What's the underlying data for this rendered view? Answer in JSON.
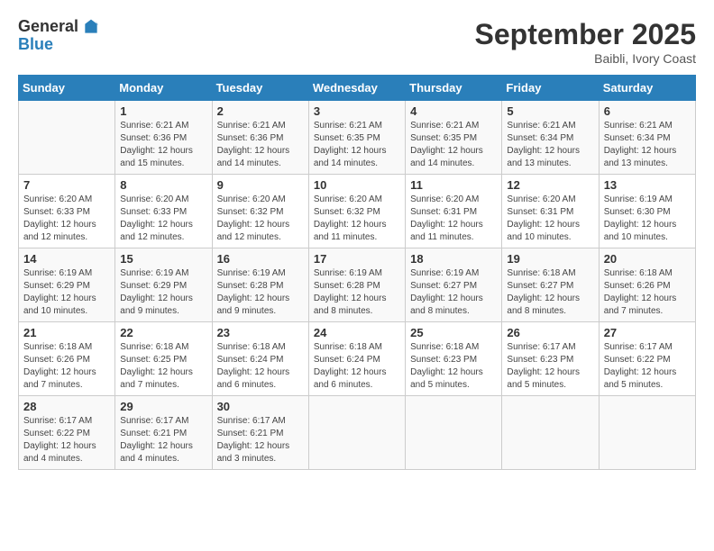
{
  "logo": {
    "general": "General",
    "blue": "Blue"
  },
  "header": {
    "month": "September 2025",
    "location": "Baibli, Ivory Coast"
  },
  "days_of_week": [
    "Sunday",
    "Monday",
    "Tuesday",
    "Wednesday",
    "Thursday",
    "Friday",
    "Saturday"
  ],
  "weeks": [
    [
      {
        "day": "",
        "sunrise": "",
        "sunset": "",
        "daylight": ""
      },
      {
        "day": "1",
        "sunrise": "Sunrise: 6:21 AM",
        "sunset": "Sunset: 6:36 PM",
        "daylight": "Daylight: 12 hours and 15 minutes."
      },
      {
        "day": "2",
        "sunrise": "Sunrise: 6:21 AM",
        "sunset": "Sunset: 6:36 PM",
        "daylight": "Daylight: 12 hours and 14 minutes."
      },
      {
        "day": "3",
        "sunrise": "Sunrise: 6:21 AM",
        "sunset": "Sunset: 6:35 PM",
        "daylight": "Daylight: 12 hours and 14 minutes."
      },
      {
        "day": "4",
        "sunrise": "Sunrise: 6:21 AM",
        "sunset": "Sunset: 6:35 PM",
        "daylight": "Daylight: 12 hours and 14 minutes."
      },
      {
        "day": "5",
        "sunrise": "Sunrise: 6:21 AM",
        "sunset": "Sunset: 6:34 PM",
        "daylight": "Daylight: 12 hours and 13 minutes."
      },
      {
        "day": "6",
        "sunrise": "Sunrise: 6:21 AM",
        "sunset": "Sunset: 6:34 PM",
        "daylight": "Daylight: 12 hours and 13 minutes."
      }
    ],
    [
      {
        "day": "7",
        "sunrise": "Sunrise: 6:20 AM",
        "sunset": "Sunset: 6:33 PM",
        "daylight": "Daylight: 12 hours and 12 minutes."
      },
      {
        "day": "8",
        "sunrise": "Sunrise: 6:20 AM",
        "sunset": "Sunset: 6:33 PM",
        "daylight": "Daylight: 12 hours and 12 minutes."
      },
      {
        "day": "9",
        "sunrise": "Sunrise: 6:20 AM",
        "sunset": "Sunset: 6:32 PM",
        "daylight": "Daylight: 12 hours and 12 minutes."
      },
      {
        "day": "10",
        "sunrise": "Sunrise: 6:20 AM",
        "sunset": "Sunset: 6:32 PM",
        "daylight": "Daylight: 12 hours and 11 minutes."
      },
      {
        "day": "11",
        "sunrise": "Sunrise: 6:20 AM",
        "sunset": "Sunset: 6:31 PM",
        "daylight": "Daylight: 12 hours and 11 minutes."
      },
      {
        "day": "12",
        "sunrise": "Sunrise: 6:20 AM",
        "sunset": "Sunset: 6:31 PM",
        "daylight": "Daylight: 12 hours and 10 minutes."
      },
      {
        "day": "13",
        "sunrise": "Sunrise: 6:19 AM",
        "sunset": "Sunset: 6:30 PM",
        "daylight": "Daylight: 12 hours and 10 minutes."
      }
    ],
    [
      {
        "day": "14",
        "sunrise": "Sunrise: 6:19 AM",
        "sunset": "Sunset: 6:29 PM",
        "daylight": "Daylight: 12 hours and 10 minutes."
      },
      {
        "day": "15",
        "sunrise": "Sunrise: 6:19 AM",
        "sunset": "Sunset: 6:29 PM",
        "daylight": "Daylight: 12 hours and 9 minutes."
      },
      {
        "day": "16",
        "sunrise": "Sunrise: 6:19 AM",
        "sunset": "Sunset: 6:28 PM",
        "daylight": "Daylight: 12 hours and 9 minutes."
      },
      {
        "day": "17",
        "sunrise": "Sunrise: 6:19 AM",
        "sunset": "Sunset: 6:28 PM",
        "daylight": "Daylight: 12 hours and 8 minutes."
      },
      {
        "day": "18",
        "sunrise": "Sunrise: 6:19 AM",
        "sunset": "Sunset: 6:27 PM",
        "daylight": "Daylight: 12 hours and 8 minutes."
      },
      {
        "day": "19",
        "sunrise": "Sunrise: 6:18 AM",
        "sunset": "Sunset: 6:27 PM",
        "daylight": "Daylight: 12 hours and 8 minutes."
      },
      {
        "day": "20",
        "sunrise": "Sunrise: 6:18 AM",
        "sunset": "Sunset: 6:26 PM",
        "daylight": "Daylight: 12 hours and 7 minutes."
      }
    ],
    [
      {
        "day": "21",
        "sunrise": "Sunrise: 6:18 AM",
        "sunset": "Sunset: 6:26 PM",
        "daylight": "Daylight: 12 hours and 7 minutes."
      },
      {
        "day": "22",
        "sunrise": "Sunrise: 6:18 AM",
        "sunset": "Sunset: 6:25 PM",
        "daylight": "Daylight: 12 hours and 7 minutes."
      },
      {
        "day": "23",
        "sunrise": "Sunrise: 6:18 AM",
        "sunset": "Sunset: 6:24 PM",
        "daylight": "Daylight: 12 hours and 6 minutes."
      },
      {
        "day": "24",
        "sunrise": "Sunrise: 6:18 AM",
        "sunset": "Sunset: 6:24 PM",
        "daylight": "Daylight: 12 hours and 6 minutes."
      },
      {
        "day": "25",
        "sunrise": "Sunrise: 6:18 AM",
        "sunset": "Sunset: 6:23 PM",
        "daylight": "Daylight: 12 hours and 5 minutes."
      },
      {
        "day": "26",
        "sunrise": "Sunrise: 6:17 AM",
        "sunset": "Sunset: 6:23 PM",
        "daylight": "Daylight: 12 hours and 5 minutes."
      },
      {
        "day": "27",
        "sunrise": "Sunrise: 6:17 AM",
        "sunset": "Sunset: 6:22 PM",
        "daylight": "Daylight: 12 hours and 5 minutes."
      }
    ],
    [
      {
        "day": "28",
        "sunrise": "Sunrise: 6:17 AM",
        "sunset": "Sunset: 6:22 PM",
        "daylight": "Daylight: 12 hours and 4 minutes."
      },
      {
        "day": "29",
        "sunrise": "Sunrise: 6:17 AM",
        "sunset": "Sunset: 6:21 PM",
        "daylight": "Daylight: 12 hours and 4 minutes."
      },
      {
        "day": "30",
        "sunrise": "Sunrise: 6:17 AM",
        "sunset": "Sunset: 6:21 PM",
        "daylight": "Daylight: 12 hours and 3 minutes."
      },
      {
        "day": "",
        "sunrise": "",
        "sunset": "",
        "daylight": ""
      },
      {
        "day": "",
        "sunrise": "",
        "sunset": "",
        "daylight": ""
      },
      {
        "day": "",
        "sunrise": "",
        "sunset": "",
        "daylight": ""
      },
      {
        "day": "",
        "sunrise": "",
        "sunset": "",
        "daylight": ""
      }
    ]
  ]
}
